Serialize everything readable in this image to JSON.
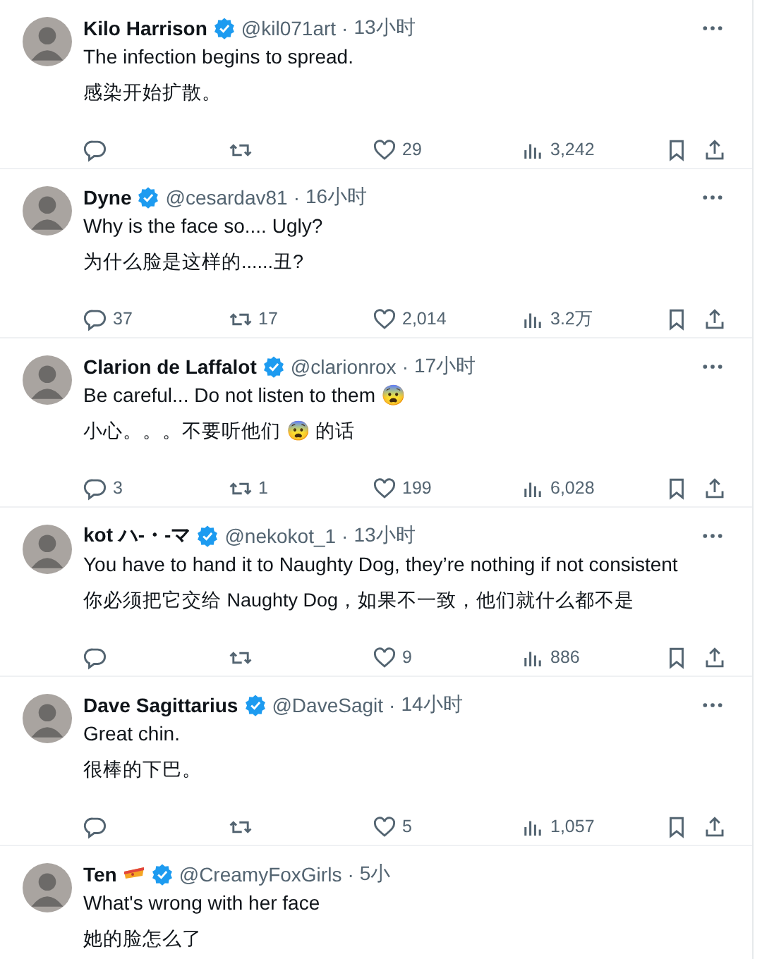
{
  "replies": [
    {
      "name": "Kilo Harrison",
      "verified": true,
      "handle": "@kil071art",
      "separator": "·",
      "time": "13小时",
      "text": "The infection begins to spread.",
      "translation": "感染开始扩散。",
      "stats": {
        "likes": "29",
        "views": "3,242"
      },
      "more": true
    },
    {
      "name": "Dyne",
      "verified": true,
      "handle": "@cesardav81",
      "separator": "·",
      "time": "16小时",
      "text": "Why is the face so.... Ugly?",
      "translation": "为什么脸是这样的......丑?",
      "stats": {
        "replies": "37",
        "reposts": "17",
        "likes": "2,014",
        "views": "3.2万"
      },
      "more": true
    },
    {
      "name": "Clarion de Laffalot",
      "verified": true,
      "handle": "@clarionrox",
      "separator": "·",
      "time": "17小时",
      "text": "Be careful... Do not listen to them 😨",
      "translation": "小心。。。不要听他们 😨 的话",
      "stats": {
        "replies": "3",
        "reposts": "1",
        "likes": "199",
        "views": "6,028"
      },
      "more": true
    },
    {
      "name": "kot ハ-・-マ",
      "verified": true,
      "handle": "@nekokot_1",
      "separator": "·",
      "time": "13小时",
      "text": "You have to hand it to Naughty Dog, they’re nothing if not consistent",
      "translation": "你必须把它交给 Naughty Dog，如果不一致，他们就什么都不是",
      "stats": {
        "likes": "9",
        "views": "886"
      },
      "more": true
    },
    {
      "name": "Dave Sagittarius",
      "verified": true,
      "handle": "@DaveSagit",
      "separator": "·",
      "time": "14小时",
      "text": "Great chin.",
      "translation": "很棒的下巴。",
      "stats": {
        "likes": "5",
        "views": "1,057"
      },
      "more": true
    },
    {
      "name": "Ten",
      "name_icon": true,
      "verified": true,
      "handle": "@CreamyFoxGirls",
      "separator": "·",
      "time": "5小",
      "text": "What's wrong with her face",
      "translation": "她的脸怎么了"
    }
  ]
}
